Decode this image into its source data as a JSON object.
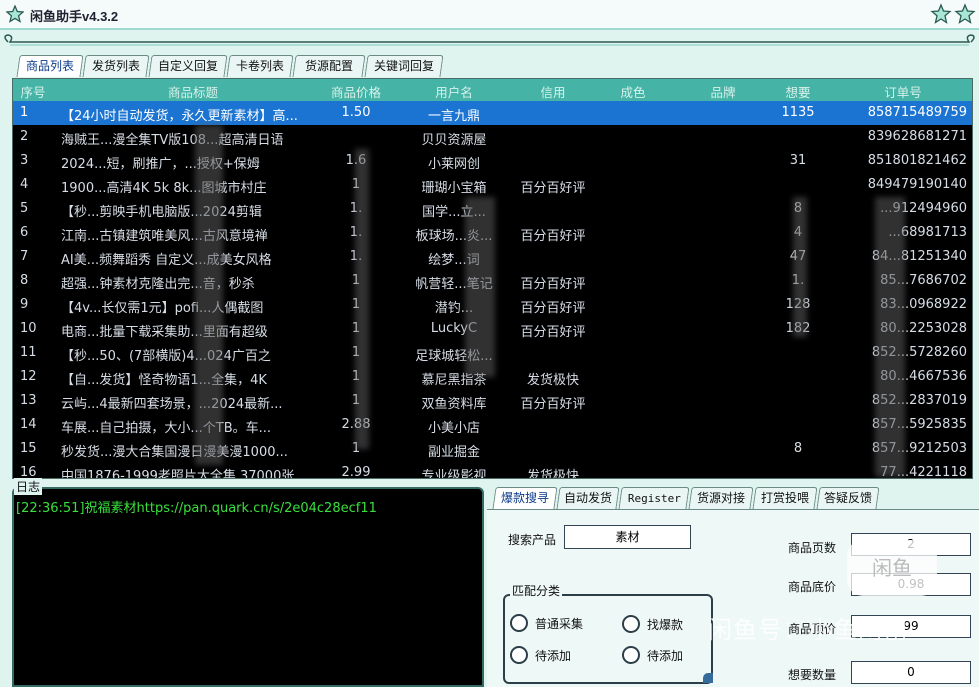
{
  "window": {
    "title": "闲鱼助手v4.3.2"
  },
  "tabs": [
    "商品列表",
    "发货列表",
    "自定义回复",
    "卡卷列表",
    "货源配置",
    "关键词回复"
  ],
  "table": {
    "headers": [
      "序号",
      "商品标题",
      "商品价格",
      "用户名",
      "信用",
      "成色",
      "品牌",
      "想要",
      "订单号"
    ],
    "rows": [
      {
        "idx": "1",
        "title": "【24小时自动发货，永久更新素材】高...",
        "price": "1.50",
        "user": "一言九鼎",
        "credit": "",
        "want": "1135",
        "order": "858715489759"
      },
      {
        "idx": "2",
        "title": "海贼王...漫全集TV版108...超高清日语",
        "price": "",
        "user": "贝贝资源屋",
        "credit": "",
        "want": "",
        "order": "839628681271"
      },
      {
        "idx": "3",
        "title": "2024...短，刷推广，...授权+保姆",
        "price": "1.6",
        "user": "小莱网创",
        "credit": "",
        "want": "31",
        "order": "851801821462"
      },
      {
        "idx": "4",
        "title": "1900...高清4K 5k 8k...图城市村庄",
        "price": "1",
        "user": "珊瑚小宝箱",
        "credit": "百分百好评",
        "want": "",
        "order": "849479190140"
      },
      {
        "idx": "5",
        "title": "【秒...剪映手机电脑版...2024剪辑",
        "price": "1.",
        "user": "国学...立...",
        "credit": "",
        "want": "8",
        "order": "...912494960"
      },
      {
        "idx": "6",
        "title": "江南...古镇建筑唯美风...古风意境禅",
        "price": "1.",
        "user": "板球场...炎...",
        "credit": "百分百好评",
        "want": "4",
        "order": "...68981713"
      },
      {
        "idx": "7",
        "title": "AI美...频舞蹈秀 自定义...成美女风格",
        "price": "1.",
        "user": "绘梦...词",
        "credit": "",
        "want": "47",
        "order": "84...81251340"
      },
      {
        "idx": "8",
        "title": "超强...钟素材克隆出完...音，秒杀",
        "price": "1",
        "user": "帆营轻...笔记",
        "credit": "百分百好评",
        "want": "1.",
        "order": "85...7686702"
      },
      {
        "idx": "9",
        "title": "【4v...长仅需1元】pofi...人偶截图",
        "price": "1",
        "user": "潜钓...",
        "credit": "百分百好评",
        "want": "128",
        "order": "83...0968922"
      },
      {
        "idx": "10",
        "title": "电商...批量下载采集助...里面有超级",
        "price": "1",
        "user": "LuckyC",
        "credit": "百分百好评",
        "want": "182",
        "order": "80...2253028"
      },
      {
        "idx": "11",
        "title": "【秒...50、(7部横版)4...024广百之",
        "price": "1",
        "user": "足球城轻松...",
        "credit": "",
        "want": "",
        "order": "852...5728260"
      },
      {
        "idx": "12",
        "title": "【自...发货】怪奇物语1...全集，4K",
        "price": "1",
        "user": "慕尼黑指茶",
        "credit": "发货极快",
        "want": "",
        "order": "80...4667536"
      },
      {
        "idx": "13",
        "title": "云屿...4最新四套场景，...2024最新...",
        "price": "1",
        "user": "双鱼资料库",
        "credit": "百分百好评",
        "want": "",
        "order": "852...2837019"
      },
      {
        "idx": "14",
        "title": "车展...自己拍摄，大小...个TB。车...",
        "price": "2.88",
        "user": "小美小店",
        "credit": "",
        "want": "",
        "order": "857...5925835"
      },
      {
        "idx": "15",
        "title": "秒发货...漫大合集国漫日漫美漫1000...",
        "price": "1",
        "user": "副业掘金",
        "credit": "",
        "want": "8",
        "order": "857...9212503"
      },
      {
        "idx": "16",
        "title": "中国1876-1999老照片大全集 37000张",
        "price": "2.99",
        "user": "专业级影视",
        "credit": "发货极快",
        "want": "",
        "order": "77...4221118"
      }
    ]
  },
  "log": {
    "label": "日志",
    "line": "[22:36:51]祝福素材https://pan.quark.cn/s/2e04c28ecf11"
  },
  "bottom_tabs": [
    "爆款搜寻",
    "自动发货",
    "Register",
    "货源对接",
    "打赏投喂",
    "答疑反馈"
  ],
  "search": {
    "label": "搜索产品",
    "value": "素材"
  },
  "match_group": {
    "label": "匹配分类",
    "options": [
      "普通采集",
      "找爆款",
      "待添加",
      "待添加"
    ]
  },
  "fields": {
    "pages_label": "商品页数",
    "pages_value": "2",
    "min_price_label": "商品底价",
    "min_price_value": "0.98",
    "max_price_label": "商品顶价",
    "max_price_value": "99",
    "want_label": "想要数量",
    "want_value": "0"
  },
  "watermark": {
    "text": "闲鱼号：小鱼网创",
    "badge": "闲鱼"
  },
  "colors": {
    "header": "#45b3a5",
    "selected_row": "#1b74d1",
    "log_text": "#39e03c",
    "table_bg": "#000000"
  }
}
